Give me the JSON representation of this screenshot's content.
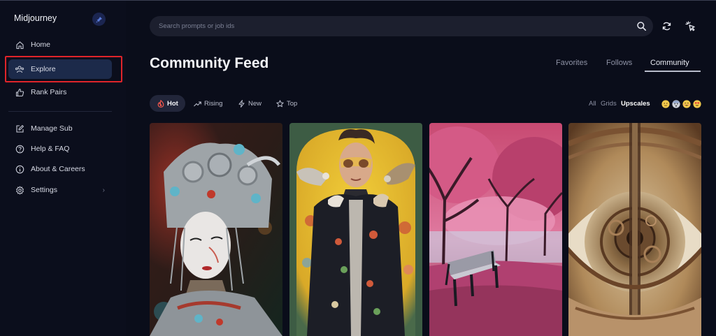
{
  "sidebar": {
    "brand": "Midjourney",
    "items": [
      {
        "label": "Home",
        "icon": "home-icon"
      },
      {
        "label": "Explore",
        "icon": "users-icon"
      },
      {
        "label": "Rank Pairs",
        "icon": "thumbs-up-icon"
      },
      {
        "label": "Manage Sub",
        "icon": "edit-icon"
      },
      {
        "label": "Help & FAQ",
        "icon": "help-icon"
      },
      {
        "label": "About & Careers",
        "icon": "info-icon"
      },
      {
        "label": "Settings",
        "icon": "gear-icon"
      }
    ],
    "active": "Explore",
    "highlight_color": "#e0242a"
  },
  "search": {
    "placeholder": "Search prompts or job ids"
  },
  "main": {
    "title": "Community Feed",
    "tabs": [
      "Favorites",
      "Follows",
      "Community"
    ],
    "active_tab": "Community",
    "sort": [
      {
        "label": "Hot",
        "icon": "flame-icon"
      },
      {
        "label": "Rising",
        "icon": "trending-up-icon"
      },
      {
        "label": "New",
        "icon": "bolt-icon"
      },
      {
        "label": "Top",
        "icon": "star-icon"
      }
    ],
    "active_sort": "Hot",
    "filters": [
      "All",
      "Grids",
      "Upscales"
    ],
    "active_filter": "Upscales",
    "reactions": [
      "😐",
      "😨",
      "😊",
      "😍"
    ]
  },
  "feed": [
    {
      "name": "geisha-headdress-image"
    },
    {
      "name": "man-with-birds-image"
    },
    {
      "name": "pink-trees-bench-image"
    },
    {
      "name": "mechanical-eye-image"
    }
  ],
  "colors": {
    "background": "#0a0d1a",
    "active_nav": "#1c2a4a",
    "accent_red": "#e0242a"
  }
}
